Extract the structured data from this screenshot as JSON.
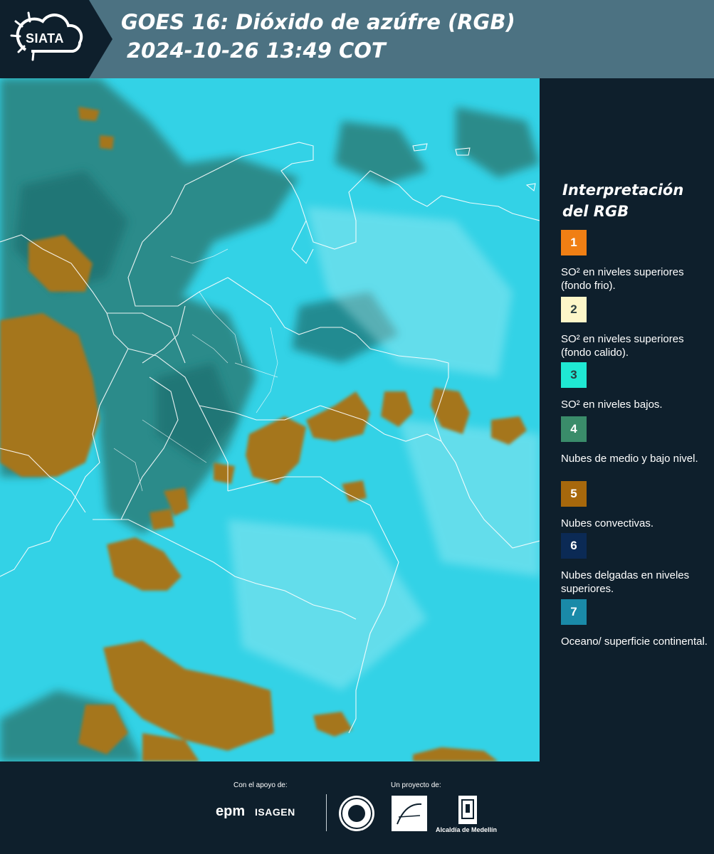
{
  "header": {
    "logo_text": "SIATA",
    "title_line1": "GOES 16: Dióxido de azúfre (RGB)",
    "title_line2": "2024-10-26 13:49 COT"
  },
  "legend": {
    "title": "Interpretación del RGB",
    "items": [
      {
        "number": "1",
        "color": "#f07f14",
        "description": "SO² en niveles superiores (fondo frio)."
      },
      {
        "number": "2",
        "color": "#fdf6c8",
        "description": "SO² en niveles superiores (fondo calido)."
      },
      {
        "number": "3",
        "color": "#1fe8d3",
        "description": "SO² en niveles bajos."
      },
      {
        "number": "4",
        "color": "#3a8c6a",
        "description": "Nubes de medio y bajo nivel."
      },
      {
        "number": "5",
        "color": "#a7680c",
        "description": "Nubes convectivas."
      },
      {
        "number": "6",
        "color": "#0b2a55",
        "description": "Nubes delgadas en niveles superiores."
      },
      {
        "number": "7",
        "color": "#1a8aa8",
        "description": "Oceano/ superficie continental."
      }
    ]
  },
  "footer": {
    "support_label": "Con el apoyo de:",
    "project_label": "Un proyecto de:",
    "sponsors": [
      "epm",
      "ISAGEN"
    ],
    "partners": [
      "Área Metropolitana Valle de Aburrá",
      "Alcaldía de Medellín"
    ],
    "alcaldia_text": "Alcaldía de Medellín"
  }
}
